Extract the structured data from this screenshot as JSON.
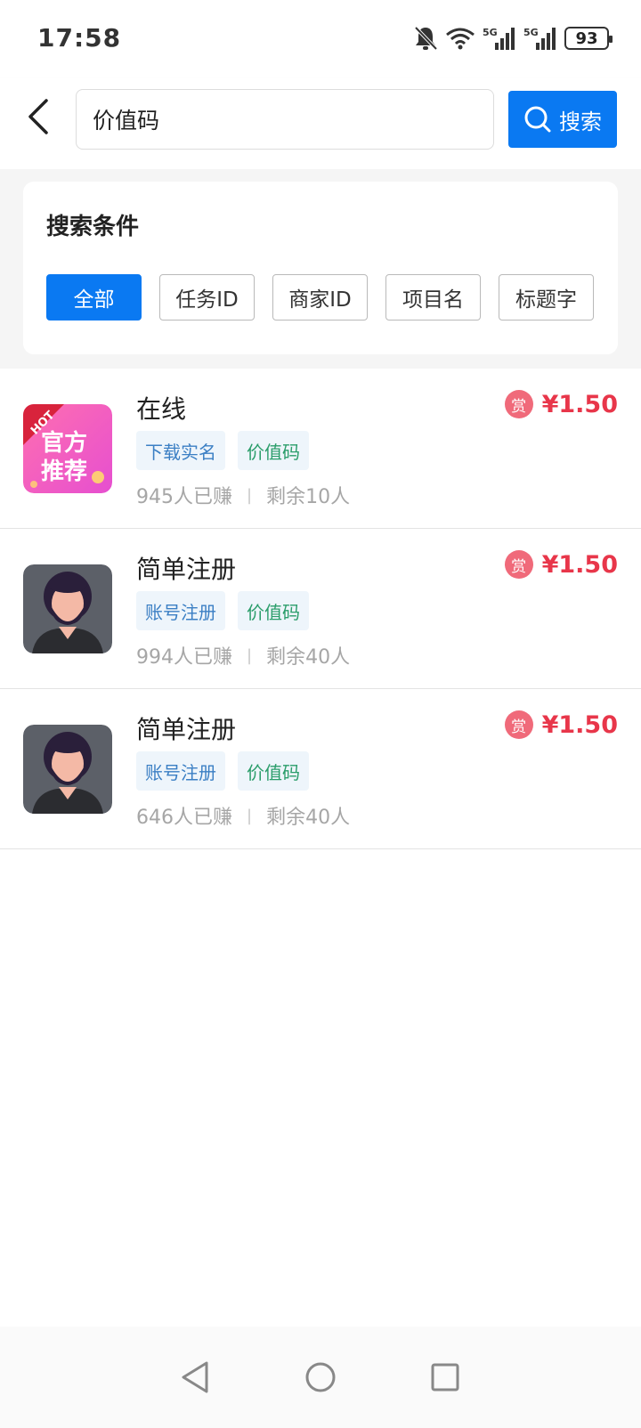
{
  "status_bar": {
    "time": "17:58",
    "battery": "93",
    "icons": [
      "bell-off-icon",
      "wifi-icon",
      "5g-signal-icon",
      "5g-signal-icon",
      "battery-icon"
    ]
  },
  "search": {
    "value": "价值码",
    "button_label": "搜索"
  },
  "filter": {
    "title": "搜索条件",
    "chips": [
      "全部",
      "任务ID",
      "商家ID",
      "项目名",
      "标题字"
    ],
    "selected": "全部"
  },
  "tasks": [
    {
      "title": "在线",
      "tags": [
        "下载实名",
        "价值码"
      ],
      "earned": "945人已赚",
      "remaining": "剩余10人",
      "reward_badge": "赏",
      "reward": "¥1.50",
      "avatar": {
        "type": "official",
        "badge": "HOT",
        "line1": "官方",
        "line2": "推荐"
      }
    },
    {
      "title": "简单注册",
      "tags": [
        "账号注册",
        "价值码"
      ],
      "earned": "994人已赚",
      "remaining": "剩余40人",
      "reward_badge": "赏",
      "reward": "¥1.50",
      "avatar": {
        "type": "person"
      }
    },
    {
      "title": "简单注册",
      "tags": [
        "账号注册",
        "价值码"
      ],
      "earned": "646人已赚",
      "remaining": "剩余40人",
      "reward_badge": "赏",
      "reward": "¥1.50",
      "avatar": {
        "type": "person"
      }
    }
  ],
  "colors": {
    "accent": "#0a79f2",
    "reward": "#e8364a",
    "tag_bg": "#eef5fb"
  }
}
